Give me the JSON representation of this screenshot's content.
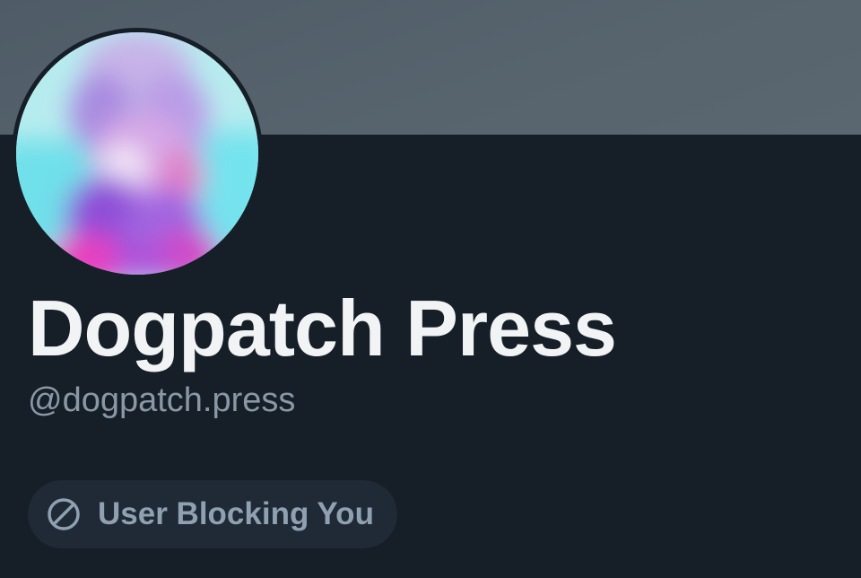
{
  "profile": {
    "display_name": "Dogpatch Press",
    "handle": "@dogpatch.press",
    "avatar_icon": "avatar-image"
  },
  "status_badge": {
    "label": "User Blocking You",
    "icon": "block-icon"
  },
  "colors": {
    "background": "#161e27",
    "banner": "#53606b",
    "name_text": "#f1f3f5",
    "handle_text": "#8a98a6",
    "badge_bg": "#1f2a36",
    "badge_text": "#8fa0b1"
  }
}
